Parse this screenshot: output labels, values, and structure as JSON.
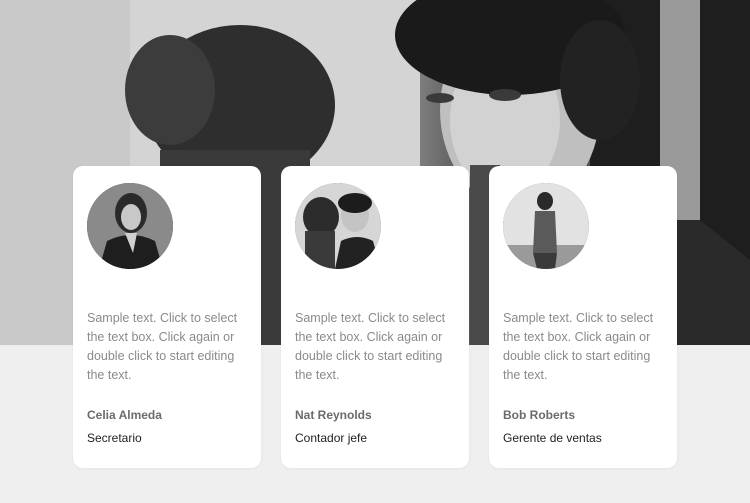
{
  "hero": {
    "image": "black-and-white-portrait-of-young-man"
  },
  "cards": [
    {
      "avatar": "woman-portrait-avatar",
      "text": "Sample text. Click to select the text box. Click again or double click to start editing the text.",
      "name": "Celia Almeda",
      "role": "Secretario"
    },
    {
      "avatar": "man-with-shadow-avatar",
      "text": "Sample text. Click to select the text box. Click again or double click to start editing the text.",
      "name": "Nat Reynolds",
      "role": "Contador jefe"
    },
    {
      "avatar": "man-seaside-avatar",
      "text": "Sample text. Click to select the text box. Click again or double click to start editing the text.",
      "name": "Bob Roberts",
      "role": "Gerente de ventas"
    }
  ],
  "colors": {
    "background": "#efefef",
    "card": "#ffffff",
    "body_text": "#8a8a8a",
    "name_text": "#6b6b6b",
    "role_text": "#222222"
  }
}
